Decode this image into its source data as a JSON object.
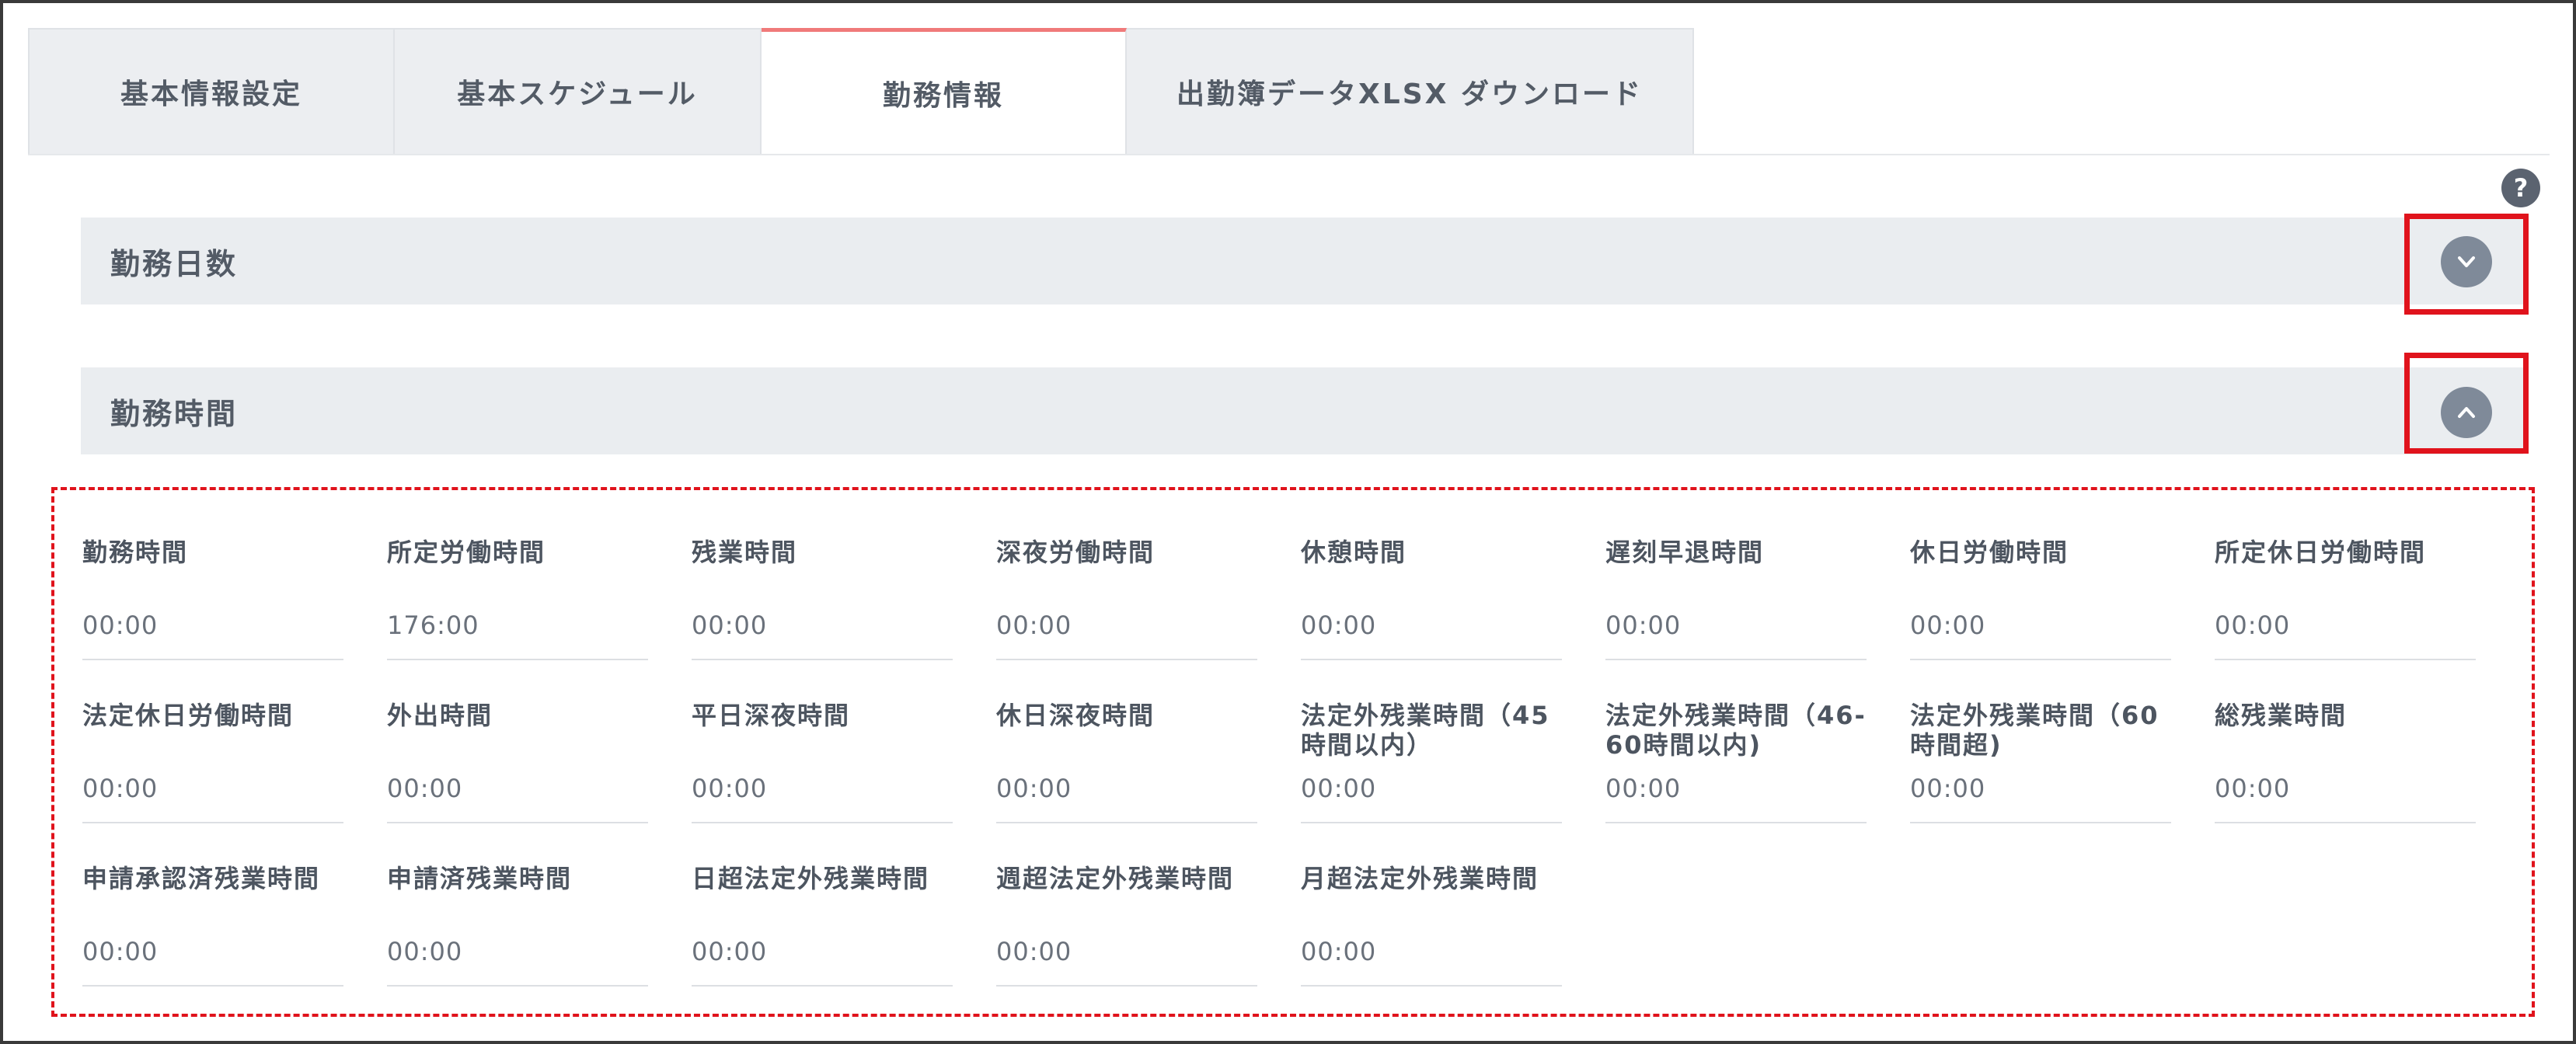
{
  "tabs": [
    {
      "label": "基本情報設定",
      "active": false
    },
    {
      "label": "基本スケジュール",
      "active": false
    },
    {
      "label": "勤務情報",
      "active": true
    },
    {
      "label": "出勤簿データXLSX ダウンロード",
      "active": false
    }
  ],
  "help_label": "?",
  "sections": {
    "days": {
      "title": "勤務日数",
      "state": "collapsed",
      "icon": "chevron-down-icon"
    },
    "hours": {
      "title": "勤務時間",
      "state": "expanded",
      "icon": "chevron-up-icon"
    }
  },
  "colors": {
    "accent_tab": "#f07a7a",
    "highlight": "#e0131c",
    "toggle": "#7f8a99"
  },
  "fields": [
    {
      "label": "勤務時間",
      "value": "00:00"
    },
    {
      "label": "所定労働時間",
      "value": "176:00"
    },
    {
      "label": "残業時間",
      "value": "00:00"
    },
    {
      "label": "深夜労働時間",
      "value": "00:00"
    },
    {
      "label": "休憩時間",
      "value": "00:00"
    },
    {
      "label": "遅刻早退時間",
      "value": "00:00"
    },
    {
      "label": "休日労働時間",
      "value": "00:00"
    },
    {
      "label": "所定休日労働時間",
      "value": "00:00"
    },
    {
      "label": "法定休日労働時間",
      "value": "00:00"
    },
    {
      "label": "外出時間",
      "value": "00:00"
    },
    {
      "label": "平日深夜時間",
      "value": "00:00"
    },
    {
      "label": "休日深夜時間",
      "value": "00:00"
    },
    {
      "label": "法定外残業時間（45時間以内）",
      "value": "00:00"
    },
    {
      "label": "法定外残業時間（46‐60時間以内)",
      "value": "00:00"
    },
    {
      "label": "法定外残業時間（60時間超)",
      "value": "00:00"
    },
    {
      "label": "総残業時間",
      "value": "00:00"
    },
    {
      "label": "申請承認済残業時間",
      "value": "00:00"
    },
    {
      "label": "申請済残業時間",
      "value": "00:00"
    },
    {
      "label": "日超法定外残業時間",
      "value": "00:00"
    },
    {
      "label": "週超法定外残業時間",
      "value": "00:00"
    },
    {
      "label": "月超法定外残業時間",
      "value": "00:00"
    }
  ]
}
